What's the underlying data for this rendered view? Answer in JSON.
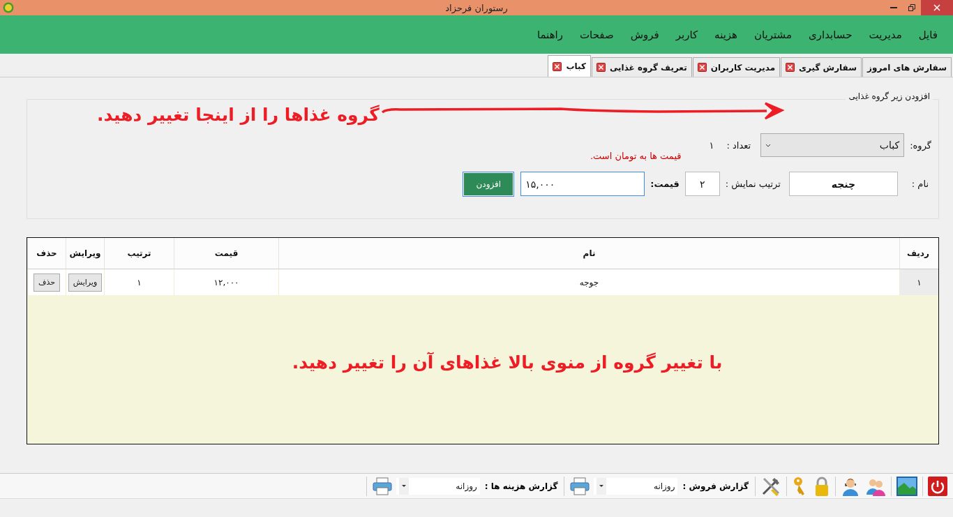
{
  "window": {
    "title": "رستوران فرحزاد"
  },
  "menu": [
    "فایل",
    "مدیریت",
    "حسابداری",
    "مشتریان",
    "هزینه",
    "کاربر",
    "فروش",
    "صفحات",
    "راهنما"
  ],
  "tabs": [
    {
      "label": "سفارش های امروز",
      "selected": false,
      "closable": false
    },
    {
      "label": "سفارش گیری",
      "selected": false,
      "closable": true
    },
    {
      "label": "مدیریت کاربران",
      "selected": false,
      "closable": true
    },
    {
      "label": "تعریف گروه غذایی",
      "selected": false,
      "closable": true
    },
    {
      "label": "کباب",
      "selected": true,
      "closable": true
    }
  ],
  "form": {
    "legend": "افزودن زیر گروه غذایی",
    "annotation": "گروه غذاها را از اینجا تغییر دهید.",
    "group_label": "گروه:",
    "group_value": "کباب",
    "count_label": "تعداد :",
    "count_value": "۱",
    "price_note": "قیمت ها به تومان است.",
    "name_label": "نام :",
    "name_value": "چنجه",
    "order_label": "ترتیب نمایش :",
    "order_value": "۲",
    "price_label": "قیمت:",
    "price_value": "۱۵,۰۰۰",
    "add_button": "افزودن"
  },
  "table": {
    "columns": [
      "ردیف",
      "نام",
      "قیمت",
      "ترتیب",
      "ویرایش",
      "حذف"
    ],
    "rows": [
      {
        "cells": [
          "۱",
          "جوجه",
          "۱۲,۰۰۰",
          "۱"
        ],
        "edit": "ویرایش",
        "delete": "حذف"
      }
    ],
    "annotation": "با تغییر گروه از منوی بالا غذاهای آن را تغییر دهید."
  },
  "toolbar": {
    "reports": [
      {
        "label": "گزارش فروش :",
        "value": "روزانه"
      },
      {
        "label": "گزارش هزینه ها :",
        "value": "روزانه"
      }
    ]
  }
}
